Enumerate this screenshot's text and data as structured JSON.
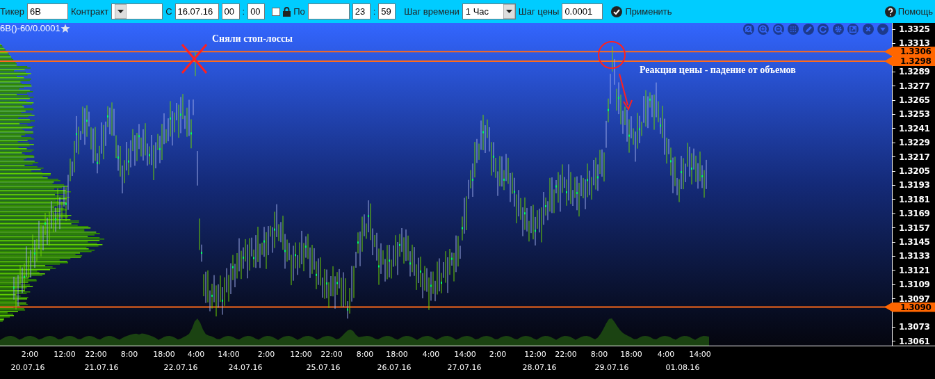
{
  "toolbar": {
    "ticker_label": "Тикер",
    "ticker": "6B",
    "contract_label": "Контракт",
    "from_label": "С",
    "from_date": "16.07.16",
    "from_hour": "00",
    "from_minute": "00",
    "time_sep_1": ":",
    "lock_checked": false,
    "to_label": "По",
    "to_hour": "23",
    "to_minute": "59",
    "time_sep_2": ":",
    "timeframe_label": "Шаг времени",
    "timeframe": "1 Час",
    "price_step_label": "Шаг цены",
    "price_step": "0.0001",
    "apply": "Применить",
    "help": "Помощь"
  },
  "chart": {
    "title": "6B()-60/0.0001",
    "favorite": false,
    "annotations": [
      {
        "kind": "label",
        "text": "Сняли стоп-лоссы"
      },
      {
        "kind": "label",
        "text": "Реакция цены - падение от объемов"
      }
    ],
    "y_axis": [
      "1.3325",
      "1.3313",
      "1.3289",
      "1.3277",
      "1.3265",
      "1.3253",
      "1.3241",
      "1.3229",
      "1.3217",
      "1.3205",
      "1.3193",
      "1.3181",
      "1.3169",
      "1.3157",
      "1.3145",
      "1.3133",
      "1.3121",
      "1.3109",
      "1.3097",
      "1.3073",
      "1.3061"
    ],
    "price_markers": [
      "1.3306",
      "1.3298",
      "1.3090"
    ],
    "x_axis_times": [
      "2:00",
      "12:00",
      "22:00",
      "8:00",
      "18:00",
      "4:00",
      "14:00",
      "2:00",
      "12:00",
      "22:00",
      "8:00",
      "18:00",
      "4:00",
      "14:00",
      "2:00",
      "12:00",
      "22:00",
      "8:00",
      "18:00",
      "4:00",
      "14:00"
    ],
    "x_axis_dates": [
      "20.07.16",
      "21.07.16",
      "22.07.16",
      "24.07.16",
      "25.07.16",
      "26.07.16",
      "27.07.16",
      "28.07.16",
      "29.07.16",
      "01.08.16"
    ]
  }
}
